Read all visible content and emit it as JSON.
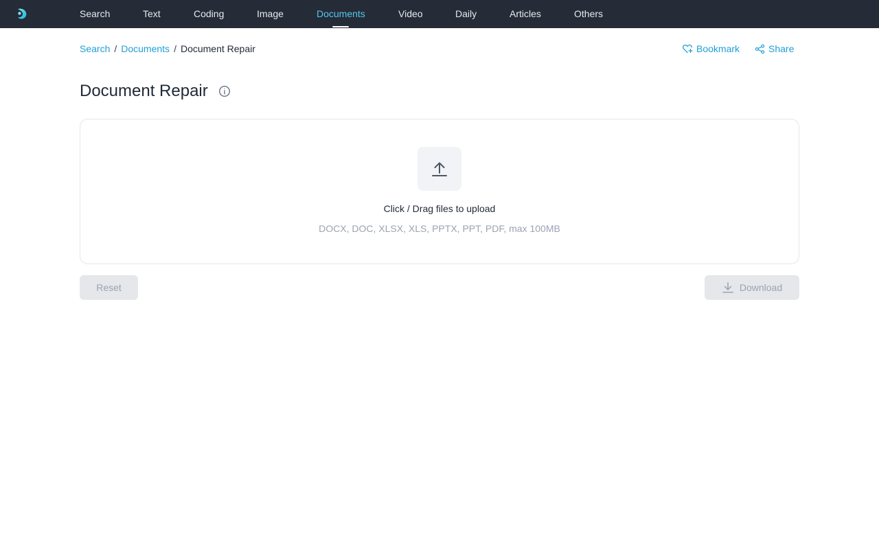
{
  "nav": {
    "items": [
      {
        "label": "Search"
      },
      {
        "label": "Text"
      },
      {
        "label": "Coding"
      },
      {
        "label": "Image"
      },
      {
        "label": "Documents",
        "active": true
      },
      {
        "label": "Video"
      },
      {
        "label": "Daily"
      },
      {
        "label": "Articles"
      },
      {
        "label": "Others"
      }
    ],
    "logo_icon": "brand-logo-icon"
  },
  "breadcrumb": {
    "items": [
      {
        "label": "Search",
        "link": true
      },
      {
        "label": "Documents",
        "link": true
      },
      {
        "label": "Document Repair",
        "link": false
      }
    ],
    "separator": "/"
  },
  "actions": {
    "bookmark_label": "Bookmark",
    "bookmark_icon": "heart-plus-icon",
    "share_label": "Share",
    "share_icon": "share-nodes-icon"
  },
  "page": {
    "title": "Document Repair",
    "info_icon": "info-circle-icon"
  },
  "upload": {
    "icon": "upload-arrow-icon",
    "prompt": "Click / Drag files to upload",
    "formats": "DOCX, DOC, XLSX, XLS, PPTX, PPT, PDF, max 100MB"
  },
  "buttons": {
    "reset_label": "Reset",
    "download_label": "Download",
    "download_icon": "download-icon",
    "disabled": true
  },
  "colors": {
    "nav_bg": "#252b37",
    "nav_active": "#53c8f0",
    "link": "#1f9fd6",
    "muted": "#9aa3b2",
    "button_bg": "#e5e7eb"
  }
}
